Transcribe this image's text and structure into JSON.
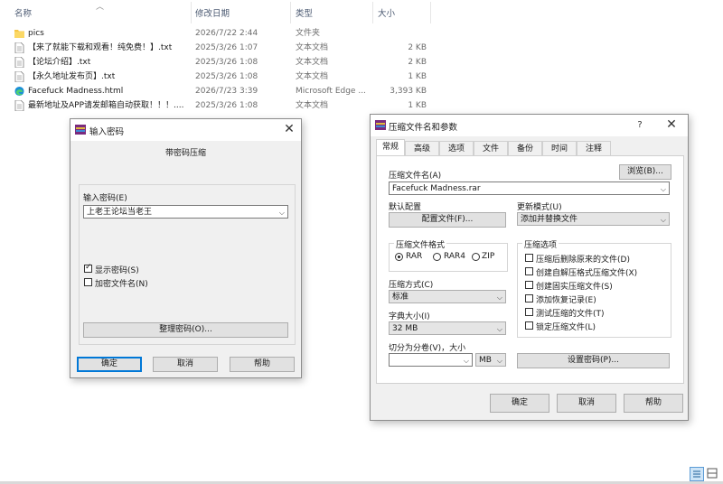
{
  "explorer": {
    "headers": {
      "name": "名称",
      "date": "修改日期",
      "type": "类型",
      "size": "大小"
    },
    "files": [
      {
        "name": "pics",
        "date": "2026/7/22 2:44",
        "type": "文件夹",
        "size": "",
        "icon": "folder-icon"
      },
      {
        "name": "【来了就能下载和观看！纯免费！】.txt",
        "date": "2025/3/26 1:07",
        "type": "文本文档",
        "size": "2 KB",
        "icon": "text-file-icon"
      },
      {
        "name": "【论坛介绍】.txt",
        "date": "2025/3/26 1:08",
        "type": "文本文档",
        "size": "2 KB",
        "icon": "text-file-icon"
      },
      {
        "name": "【永久地址发布页】.txt",
        "date": "2025/3/26 1:08",
        "type": "文本文档",
        "size": "1 KB",
        "icon": "text-file-icon"
      },
      {
        "name": "Facefuck Madness.html",
        "date": "2026/7/23 3:39",
        "type": "Microsoft Edge ...",
        "size": "3,393 KB",
        "icon": "edge-icon"
      },
      {
        "name": "最新地址及APP请发邮箱自动获取！！！....",
        "date": "2025/3/26 1:08",
        "type": "文本文档",
        "size": "1 KB",
        "icon": "text-file-icon"
      }
    ]
  },
  "password_dialog": {
    "title": "输入密码",
    "subtitle": "带密码压缩",
    "input_label": "输入密码(E)",
    "input_value": "上老王论坛当老王",
    "show_password": "显示密码(S)",
    "show_password_checked": true,
    "encrypt_filenames": "加密文件名(N)",
    "encrypt_filenames_checked": false,
    "organize_button": "整理密码(O)...",
    "ok": "确定",
    "cancel": "取消",
    "help": "帮助"
  },
  "archive_dialog": {
    "title": "压缩文件名和参数",
    "help_mark": "?",
    "tabs": [
      "常规",
      "高级",
      "选项",
      "文件",
      "备份",
      "时间",
      "注释"
    ],
    "active_tab": 0,
    "archive_name_label": "压缩文件名(A)",
    "browse_button": "浏览(B)...",
    "archive_name_value": "Facefuck Madness.rar",
    "default_profile_label": "默认配置",
    "profile_button": "配置文件(F)...",
    "update_mode_label": "更新模式(U)",
    "update_mode_value": "添加并替换文件",
    "format_group": "压缩文件格式",
    "formats": [
      "RAR",
      "RAR4",
      "ZIP"
    ],
    "selected_format": 0,
    "options_group": "压缩选项",
    "options": [
      "压缩后删除原来的文件(D)",
      "创建自解压格式压缩文件(X)",
      "创建固实压缩文件(S)",
      "添加恢复记录(E)",
      "测试压缩的文件(T)",
      "锁定压缩文件(L)"
    ],
    "method_label": "压缩方式(C)",
    "method_value": "标准",
    "dict_label": "字典大小(I)",
    "dict_value": "32 MB",
    "split_label": "切分为分卷(V)，大小",
    "split_value": "",
    "split_unit": "MB",
    "set_password_button": "设置密码(P)...",
    "ok": "确定",
    "cancel": "取消",
    "help": "帮助"
  }
}
